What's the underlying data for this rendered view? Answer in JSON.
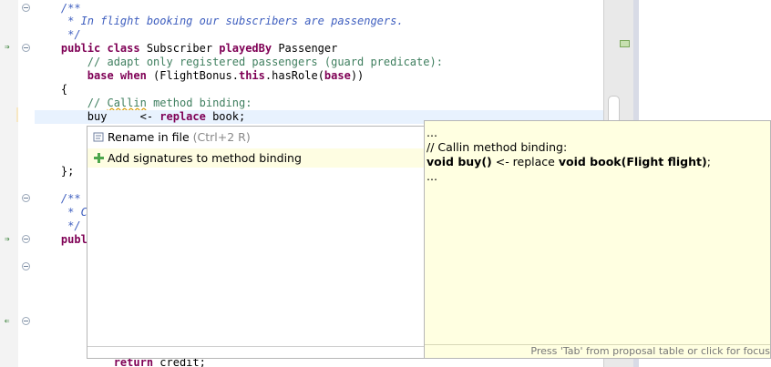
{
  "editor": {
    "lines": [
      {
        "key": "l1",
        "segs": [
          {
            "t": "    /**",
            "c": "jd"
          }
        ]
      },
      {
        "key": "l2",
        "segs": [
          {
            "t": "     * In flight booking our subscribers are passengers.",
            "c": "jd"
          }
        ]
      },
      {
        "key": "l3",
        "segs": [
          {
            "t": "     */",
            "c": "jd"
          }
        ]
      },
      {
        "key": "l4",
        "segs": [
          {
            "t": "    public class",
            "c": "kw"
          },
          {
            "t": " Subscriber ",
            "c": ""
          },
          {
            "t": "playedBy",
            "c": "kw"
          },
          {
            "t": " Passenger",
            "c": ""
          }
        ]
      },
      {
        "key": "l5",
        "segs": [
          {
            "t": "        // adapt only registered passengers (guard predicate):",
            "c": "cm"
          }
        ]
      },
      {
        "key": "l6",
        "segs": [
          {
            "t": "        ",
            "c": ""
          },
          {
            "t": "base when",
            "c": "kw"
          },
          {
            "t": " (FlightBonus.",
            "c": ""
          },
          {
            "t": "this",
            "c": "kw"
          },
          {
            "t": ".hasRole(",
            "c": ""
          },
          {
            "t": "base",
            "c": "kw"
          },
          {
            "t": "))",
            "c": ""
          }
        ]
      },
      {
        "key": "l7",
        "segs": [
          {
            "t": "    {",
            "c": ""
          }
        ]
      },
      {
        "key": "l8",
        "segs": [
          {
            "t": "        // ",
            "c": "cm"
          },
          {
            "t": "Callin",
            "c": "cm squig"
          },
          {
            "t": " method binding:",
            "c": "cm"
          }
        ]
      },
      {
        "key": "l9",
        "segs": [
          {
            "t": "        buy     <- ",
            "c": ""
          },
          {
            "t": "replace",
            "c": "kw"
          },
          {
            "t": " book;",
            "c": ""
          }
        ]
      },
      {
        "key": "l12",
        "segs": [
          {
            "t": "    };",
            "c": ""
          }
        ]
      },
      {
        "key": "l14",
        "segs": [
          {
            "t": "    /**",
            "c": "jd"
          }
        ]
      },
      {
        "key": "l15",
        "segs": [
          {
            "t": "     * C",
            "c": "jd"
          }
        ]
      },
      {
        "key": "l16",
        "segs": [
          {
            "t": "     */",
            "c": "jd"
          }
        ]
      },
      {
        "key": "l17",
        "segs": [
          {
            "t": "    publ",
            "c": "kw"
          }
        ]
      },
      {
        "key": "l26",
        "segs": [
          {
            "t": "            ",
            "c": ""
          },
          {
            "t": "return",
            "c": "kw"
          },
          {
            "t": " credit;",
            "c": ""
          }
        ]
      }
    ]
  },
  "proposals": {
    "items": [
      {
        "icon": "rename-icon",
        "label": "Rename in file",
        "shortcut": " (Ctrl+2 R)"
      },
      {
        "icon": "add-icon",
        "label": "Add signatures to method binding",
        "shortcut": ""
      }
    ]
  },
  "info": {
    "lines": [
      {
        "segs": [
          {
            "t": "...",
            "b": false
          }
        ]
      },
      {
        "segs": [
          {
            "t": "// Callin method binding:",
            "b": false
          }
        ]
      },
      {
        "segs": [
          {
            "t": "void buy()",
            "b": true
          },
          {
            "t": " <- replace ",
            "b": false
          },
          {
            "t": "void book(Flight flight)",
            "b": true
          },
          {
            "t": ";",
            "b": false
          }
        ]
      },
      {
        "segs": [
          {
            "t": "...",
            "b": false
          }
        ]
      }
    ],
    "status": "Press 'Tab' from proposal table or click for focus"
  }
}
